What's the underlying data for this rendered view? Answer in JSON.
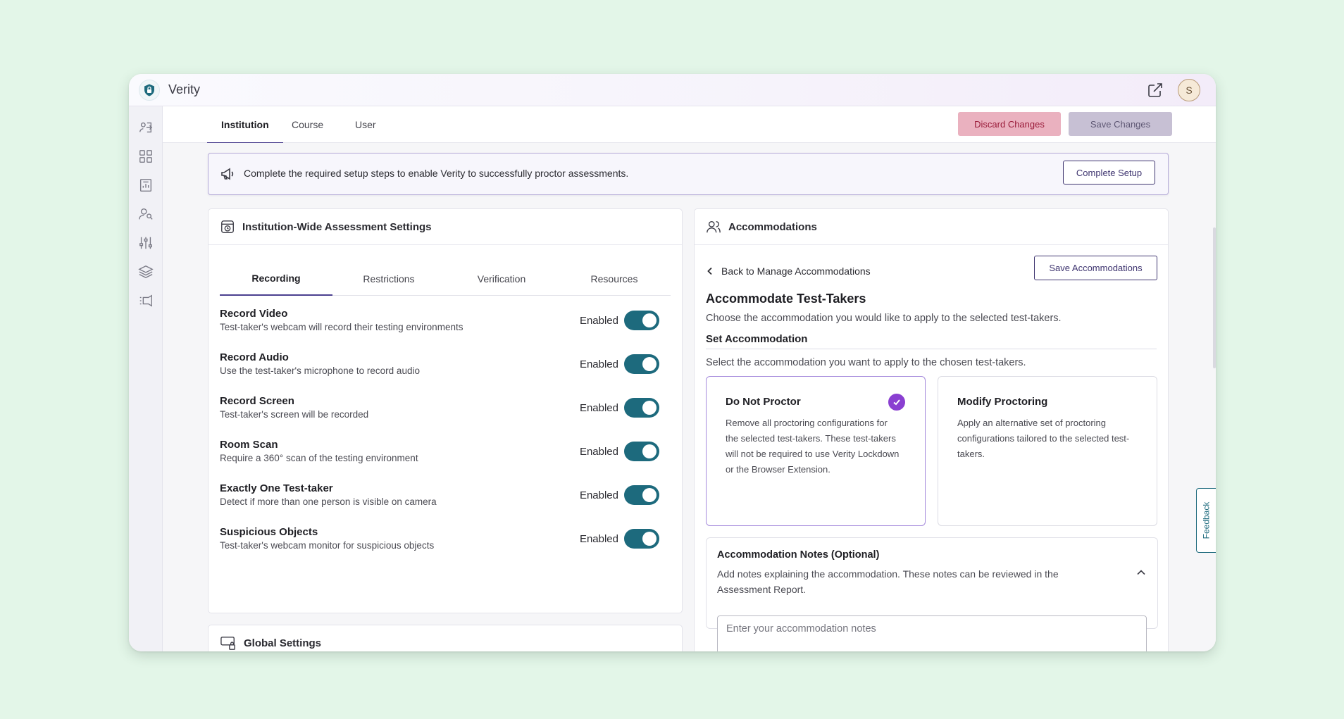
{
  "app": {
    "title": "Verity",
    "avatar_initial": "S"
  },
  "nav": {
    "tabs": [
      {
        "label": "Institution",
        "active": true
      },
      {
        "label": "Course",
        "active": false
      },
      {
        "label": "User",
        "active": false
      }
    ],
    "discard_label": "Discard Changes",
    "save_label": "Save Changes"
  },
  "banner": {
    "text": "Complete the required setup steps to enable Verity to successfully proctor assessments.",
    "button_label": "Complete Setup"
  },
  "assessment_settings": {
    "title": "Institution-Wide Assessment Settings",
    "subtabs": [
      {
        "label": "Recording",
        "active": true
      },
      {
        "label": "Restrictions",
        "active": false
      },
      {
        "label": "Verification",
        "active": false
      },
      {
        "label": "Resources",
        "active": false
      }
    ],
    "settings": [
      {
        "title": "Record Video",
        "desc": "Test-taker's webcam will record their testing environments",
        "status": "Enabled",
        "on": true
      },
      {
        "title": "Record Audio",
        "desc": "Use the test-taker's microphone to record audio",
        "status": "Enabled",
        "on": true
      },
      {
        "title": "Record Screen",
        "desc": "Test-taker's screen will be recorded",
        "status": "Enabled",
        "on": true
      },
      {
        "title": "Room Scan",
        "desc": "Require a 360° scan of the testing environment",
        "status": "Enabled",
        "on": true
      },
      {
        "title": "Exactly One Test-taker",
        "desc": "Detect if more than one person is visible on camera",
        "status": "Enabled",
        "on": true
      },
      {
        "title": "Suspicious Objects",
        "desc": "Test-taker's webcam monitor for suspicious objects",
        "status": "Enabled",
        "on": true
      }
    ]
  },
  "global_settings": {
    "title": "Global Settings"
  },
  "accommodations": {
    "title": "Accommodations",
    "back_label": "Back to Manage Accommodations",
    "save_label": "Save Accommodations",
    "heading": "Accommodate Test-Takers",
    "subheading": "Choose the accommodation you would like to apply to the selected test-takers.",
    "set_title": "Set Accommodation",
    "set_sub": "Select the accommodation you want to apply to the chosen test-takers.",
    "options": [
      {
        "title": "Do Not Proctor",
        "desc": "Remove all proctoring configurations for the selected test-takers. These test-takers will not be required to use Verity Lockdown or the Browser Extension.",
        "selected": true
      },
      {
        "title": "Modify Proctoring",
        "desc": "Apply an alternative set of proctoring configurations tailored to the selected test-takers.",
        "selected": false
      }
    ],
    "notes": {
      "title": "Accommodation Notes (Optional)",
      "desc": "Add notes explaining the accommodation. These notes can be reviewed in the Assessment Report.",
      "placeholder": "Enter your accommodation notes"
    }
  },
  "feedback_label": "Feedback",
  "colors": {
    "accent": "#4b3f8f",
    "toggle": "#1d6a7d",
    "check": "#8a3fd1",
    "discard_bg": "#eab1bf",
    "background": "#e3f6e8"
  }
}
